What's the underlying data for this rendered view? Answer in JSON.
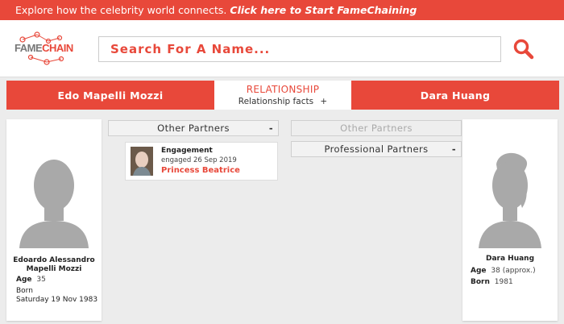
{
  "topbar": {
    "text": "Explore how the celebrity world connects.",
    "cta": "Click here to Start FameChaining"
  },
  "header": {
    "logo_fame": "FAME",
    "logo_chain": "CHAIN",
    "search_placeholder": "Search For A Name...",
    "search_icon": "search-icon"
  },
  "relationship_bar": {
    "person_left": "Edo Mapelli Mozzi",
    "title": "RELATIONSHIP",
    "facts_label": "Relationship facts",
    "facts_toggle": "+",
    "person_right": "Dara Huang"
  },
  "left_profile": {
    "name_line1": "Edoardo Alessandro",
    "name_line2": "Mapelli Mozzi",
    "age_label": "Age",
    "age_value": "35",
    "born_label": "Born",
    "born_value": "Saturday 19 Nov 1983"
  },
  "right_profile": {
    "name": "Dara Huang",
    "age_label": "Age",
    "age_value": "38 (approx.)",
    "born_label": "Born",
    "born_value": "1981"
  },
  "left_sections": [
    {
      "label": "Other Partners",
      "toggle": "-"
    }
  ],
  "right_sections": [
    {
      "label": "Other Partners",
      "toggle": "",
      "disabled": true
    },
    {
      "label": "Professional Partners",
      "toggle": "-"
    }
  ],
  "partner_card": {
    "type": "Engagement",
    "date": "engaged 26 Sep 2019",
    "name": "Princess Beatrice"
  },
  "colors": {
    "accent": "#e8483a",
    "background": "#ececec"
  }
}
